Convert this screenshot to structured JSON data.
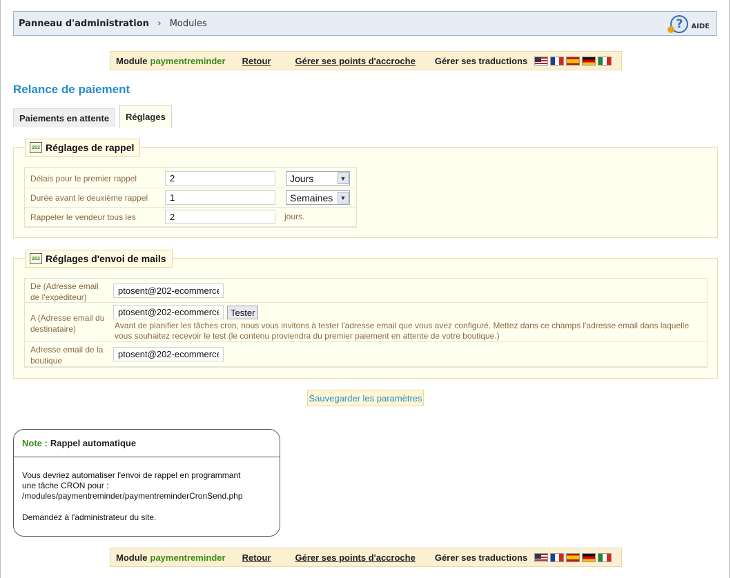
{
  "header": {
    "breadcrumb_root": "Panneau d'administration",
    "breadcrumb_sep": ">",
    "breadcrumb_current": "Modules",
    "help_label": "AIDE"
  },
  "modbar": {
    "module_prefix": "Module",
    "module_name": "paymentreminder",
    "back_link": "Retour",
    "hooks_link": "Gérer ses points d'accroche",
    "translations_label": "Gérer ses traductions",
    "flags": [
      "us",
      "fr",
      "es",
      "de",
      "it"
    ]
  },
  "page_title": "Relance de paiement",
  "tabs": {
    "pending": "Paiements en attente",
    "settings": "Réglages"
  },
  "reminder_settings": {
    "legend": "Réglages de rappel",
    "logo_text": "202",
    "rows": [
      {
        "label": "Délais pour le premier rappel",
        "value": "2",
        "unit_select": "Jours"
      },
      {
        "label": "Durée avant le deuxième rappel",
        "value": "1",
        "unit_select": "Semaines"
      },
      {
        "label": "Rappeler le vendeur tous les",
        "value": "2",
        "unit_text": "jours."
      }
    ]
  },
  "mail_settings": {
    "legend": "Réglages d'envoi de mails",
    "logo_text": "202",
    "from_label": "De (Adresse email de l'expéditeur)",
    "from_value": "ptosent@202-ecommerce",
    "to_label": "A (Adresse email du destinataire)",
    "to_value": "ptosent@202-ecommerce",
    "test_button": "Tester",
    "to_help": "Avant de planifier les tâches cron, nous vous invitons à tester l'adresse email que vous avez configuré. Mettez dans ce champs l'adresse email dans laquelle vous souhaitez recevoir le test (le contenu proviendra du premier paiement en attente de votre boutique.)",
    "shop_label": "Adresse email de la boutique",
    "shop_value": "ptosent@202-ecommerce"
  },
  "save_button": "Sauvegarder les paramètres",
  "note": {
    "note_word": "Note :",
    "title": "Rappel automatique",
    "line1": "Vous devriez automatiser l'envoi de rappel en programmant",
    "line2": "une tâche CRON pour :",
    "line3": "/modules/paymentreminder/paymentreminderCronSend.php",
    "line4": "Demandez à l'administrateur du site."
  },
  "colors": {
    "title_blue": "#268ccd",
    "module_green": "#3b8c1c",
    "label_brown": "#8a6a40",
    "panel_bg": "#fffff0"
  }
}
